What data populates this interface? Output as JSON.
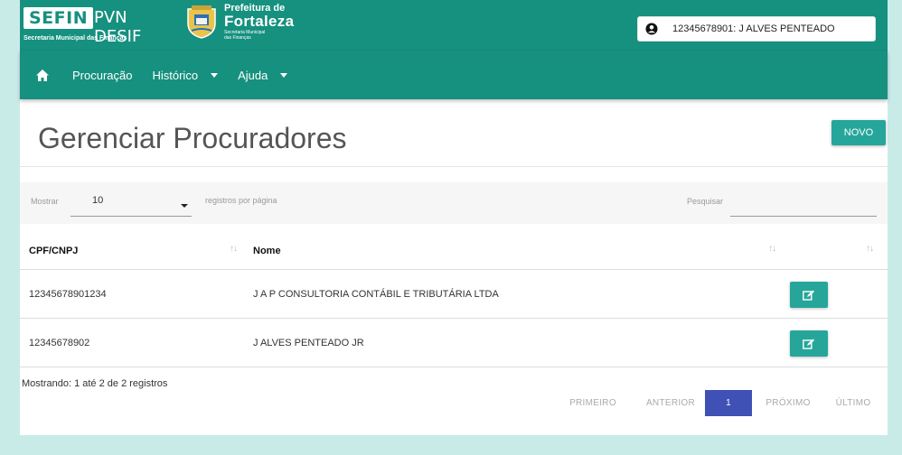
{
  "header": {
    "sefin_logo": "SEFIN",
    "app_name": "PVN DESIF",
    "sefin_subtitle": "Secretaria Municipal das Finanças",
    "prefeitura_line1": "Prefeitura de",
    "prefeitura_line2": "Fortaleza",
    "prefeitura_line3": "Secretaria Municipal",
    "prefeitura_line4": "das Finanças",
    "user": "12345678901: J ALVES PENTEADO",
    "user_icon": "user-circle-icon"
  },
  "nav": {
    "home_icon": "home-icon",
    "items": [
      {
        "label": "Procuração"
      },
      {
        "label": "Histórico"
      },
      {
        "label": "Ajuda"
      }
    ]
  },
  "main": {
    "title": "Gerenciar Procuradores",
    "new_button": "NOVO"
  },
  "table_controls": {
    "show_label": "Mostrar",
    "page_size": "10",
    "per_page_label": "registros por página",
    "search_label": "Pesquisar",
    "search_value": ""
  },
  "table": {
    "columns": [
      "CPF/CNPJ",
      "Nome"
    ],
    "rows": [
      {
        "cpf_cnpj": "12345678901234",
        "nome": "J A P CONSULTORIA CONTÁBIL E TRIBUTÁRIA LTDA"
      },
      {
        "cpf_cnpj": "12345678902",
        "nome": "J ALVES PENTEADO JR"
      }
    ]
  },
  "footer": {
    "info": "Mostrando: 1 até 2 de 2 registros",
    "pagination": {
      "first": "PRIMEIRO",
      "prev": "ANTERIOR",
      "current": "1",
      "next": "PRÓXIMO",
      "last": "ÚLTIMO"
    }
  },
  "colors": {
    "primary": "#16907f",
    "button": "#26a69a",
    "page_active": "#3f51b5",
    "background": "#c9ebe8"
  }
}
